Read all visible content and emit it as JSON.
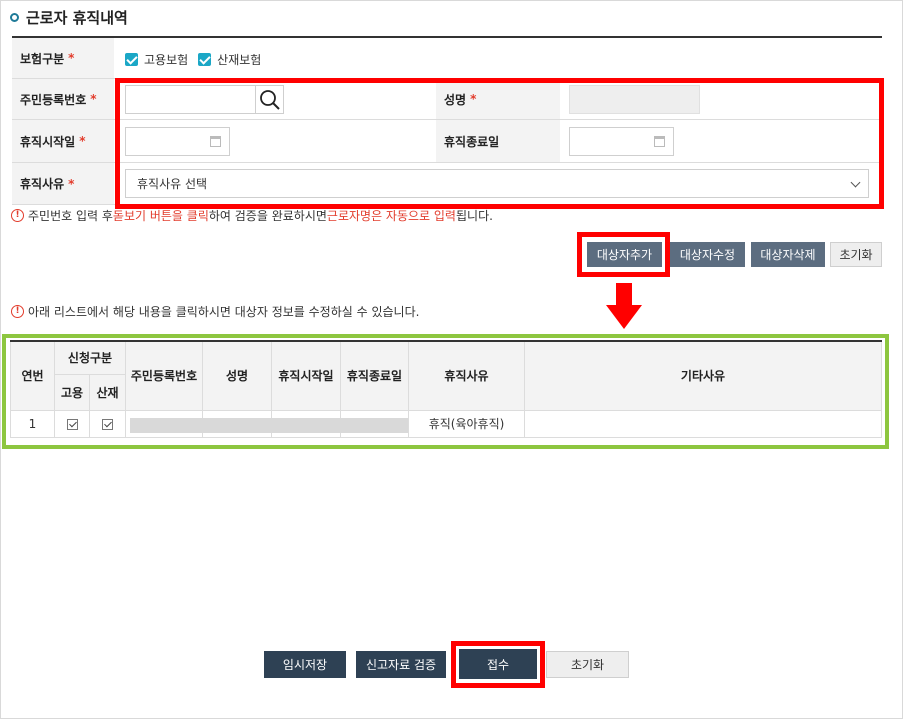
{
  "section": {
    "title": "근로자 휴직내역"
  },
  "form": {
    "insurance": {
      "label": "보험구분",
      "required": "*",
      "options": [
        {
          "label": "고용보험",
          "checked": true
        },
        {
          "label": "산재보험",
          "checked": true
        }
      ]
    },
    "rrn": {
      "label": "주민등록번호",
      "required": "*",
      "value": ""
    },
    "name": {
      "label": "성명",
      "required": "*",
      "value": ""
    },
    "leave_start": {
      "label": "휴직시작일",
      "required": "*",
      "value": ""
    },
    "leave_end": {
      "label": "휴직종료일",
      "value": ""
    },
    "reason": {
      "label": "휴직사유",
      "required": "*",
      "selected": "휴직사유 선택"
    }
  },
  "notice1": {
    "part1": "주민번호 입력 후 ",
    "hl1": "돋보기 버튼을 클릭",
    "part2": "하여 검증을 완료하시면 ",
    "hl2": "근로자명은 자동으로 입력",
    "part3": "됩니다."
  },
  "target_buttons": {
    "add": "대상자추가",
    "edit": "대상자수정",
    "delete": "대상자삭제",
    "reset": "초기화"
  },
  "notice2": "아래 리스트에서 해당 내용을 클릭하시면 대상자 정보를 수정하실 수 있습니다.",
  "table": {
    "headers": {
      "seq": "연번",
      "apply_type": "신청구분",
      "employment": "고용",
      "accident": "산재",
      "rrn": "주민등록번호",
      "name": "성명",
      "start": "휴직시작일",
      "end": "휴직종료일",
      "reason": "휴직사유",
      "other_reason": "기타사유"
    },
    "rows": [
      {
        "seq": "1",
        "employment": true,
        "accident": true,
        "rrn": "",
        "name": "",
        "start": "",
        "end": "",
        "reason": "휴직(육아휴직)",
        "other_reason": ""
      }
    ]
  },
  "bottom_buttons": {
    "temp_save": "임시저장",
    "verify": "신고자료 검증",
    "submit": "접수",
    "reset": "초기화"
  },
  "colors": {
    "highlight_red": "#ff0000",
    "highlight_green": "#8dc63f",
    "accent": "#1ba7c6",
    "button_dark": "#5c6d80",
    "button_navy": "#2e4154"
  }
}
